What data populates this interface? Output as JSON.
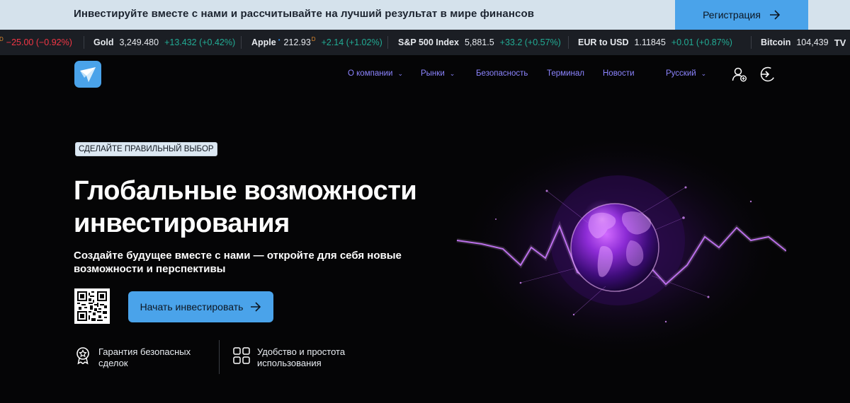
{
  "topbar": {
    "text": "Инвестируйте вместе с нами и рассчитывайте на лучший результат в мире финансов",
    "register_label": "Регистрация"
  },
  "ticker": [
    {
      "name": "",
      "price": "",
      "change": "−25.00 (−0.92%)",
      "dir": "down",
      "prefix_sup": "D"
    },
    {
      "name": "Gold",
      "price": "3,249.480",
      "change": "+13.432 (+0.42%)",
      "dir": "up"
    },
    {
      "name": "Apple",
      "price": "212.93",
      "change": "+2.14 (+1.02%)",
      "dir": "up",
      "dot": "•",
      "sup": "D"
    },
    {
      "name": "S&P 500 Index",
      "price": "5,881.5",
      "change": "+33.2 (+0.57%)",
      "dir": "up"
    },
    {
      "name": "EUR to USD",
      "price": "1.11845",
      "change": "+0.01 (+0.87%)",
      "dir": "up"
    },
    {
      "name": "Bitcoin",
      "price": "104,439",
      "change": "",
      "dir": "up"
    }
  ],
  "nav": {
    "about": "О компании",
    "markets": "Рынки",
    "security": "Безопасность",
    "terminal": "Терминал",
    "news": "Новости",
    "language": "Русский"
  },
  "hero": {
    "badge": "СДЕЛАЙТЕ ПРАВИЛЬНЫЙ ВЫБОР",
    "title_line1": "Глобальные возможности",
    "title_line2": "инвестирования",
    "subtitle": "Создайте будущее вместе с нами — откройте для себя новые возможности и перспективы",
    "cta_label": "Начать инвестировать"
  },
  "features": [
    {
      "text": "Гарантия безопасных сделок",
      "icon": "medal-star-icon"
    },
    {
      "text": "Удобство и простота использования",
      "icon": "grid-icon"
    }
  ],
  "colors": {
    "accent": "#4aa3ea",
    "nav": "#8c84ff",
    "up": "#22ab94",
    "down": "#f23645",
    "ticker_bg": "#1b1e24",
    "topbar_bg": "#d5e2ec"
  },
  "tradingview_logo": "TV"
}
